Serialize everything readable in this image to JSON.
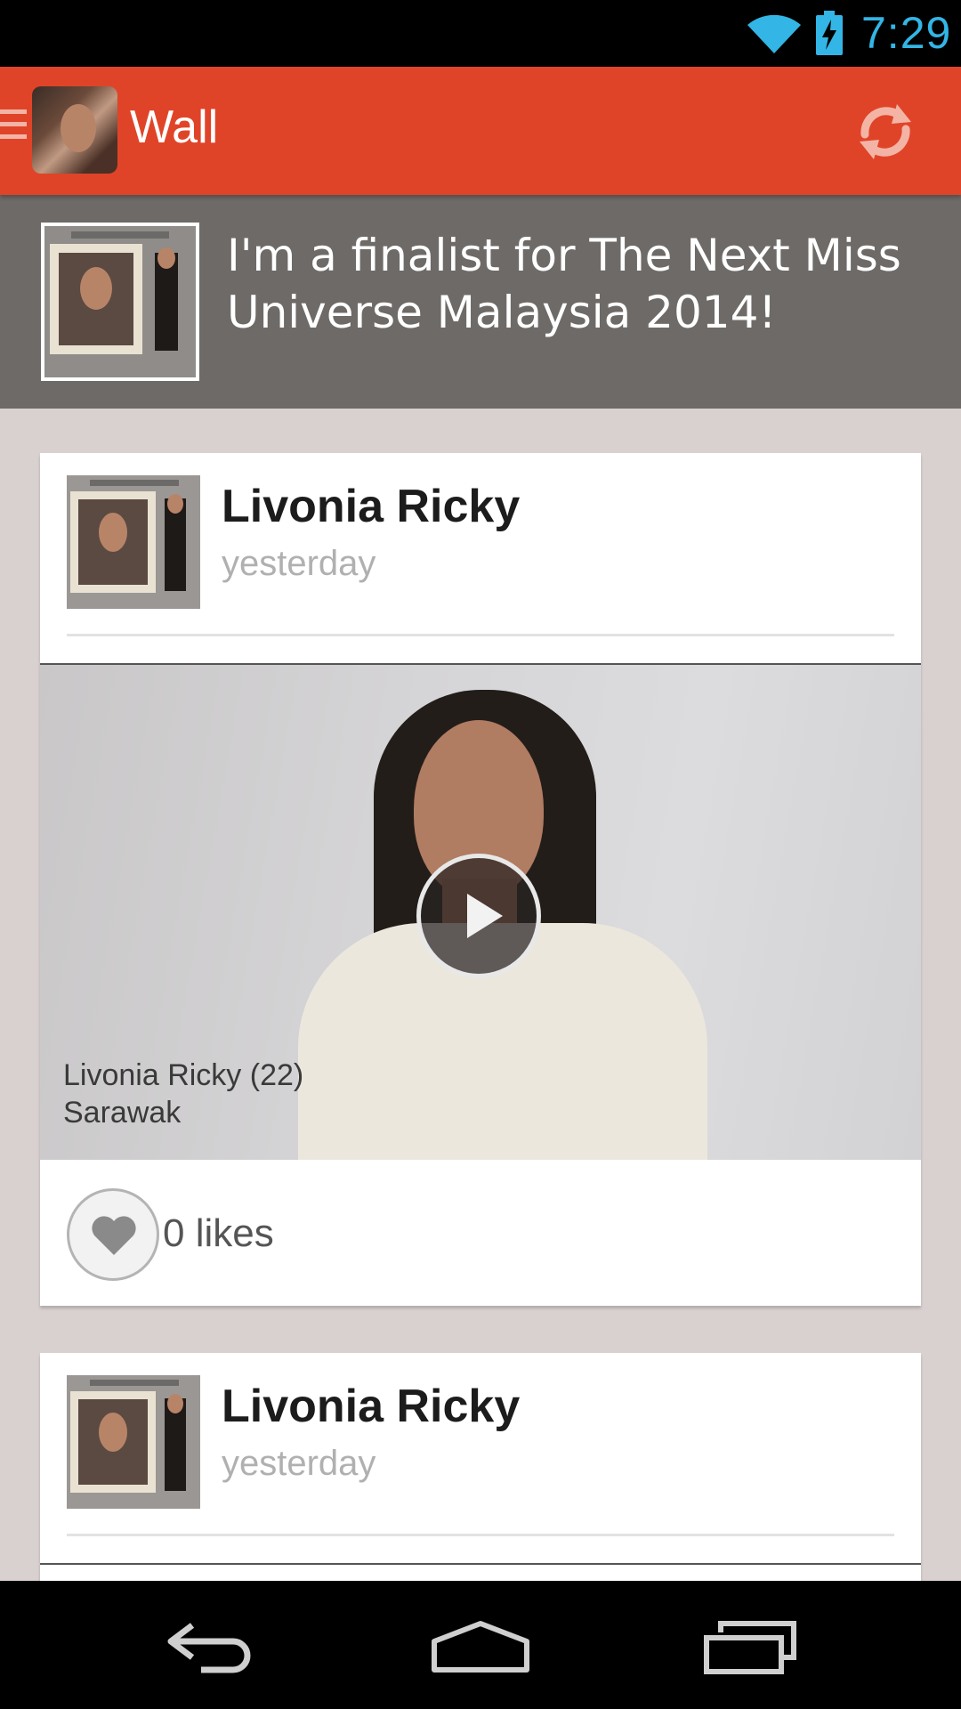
{
  "status_bar": {
    "time": "7:29",
    "icons": [
      "wifi-icon",
      "battery-charging-icon"
    ],
    "time_color": "#33b5e5"
  },
  "action_bar": {
    "title": "Wall",
    "background": "#e04428",
    "icons": [
      "menu-icon",
      "app-avatar",
      "refresh-icon"
    ]
  },
  "banner": {
    "text": "I'm a finalist for The Next Miss Universe Malaysia 2014!"
  },
  "feed": {
    "posts": [
      {
        "author": "Livonia Ricky",
        "time": "yesterday",
        "video": {
          "caption_line1": "Livonia Ricky (22)",
          "caption_line2": "Sarawak"
        },
        "likes": "0 likes"
      },
      {
        "author": "Livonia Ricky",
        "time": "yesterday"
      }
    ]
  },
  "nav_bar": {
    "icons": [
      "back-icon",
      "home-icon",
      "recent-apps-icon"
    ]
  }
}
